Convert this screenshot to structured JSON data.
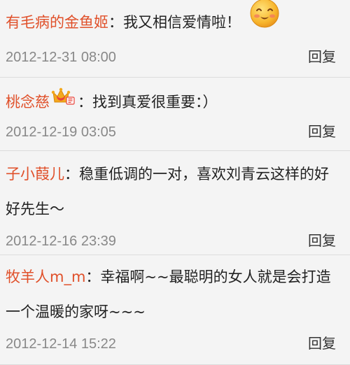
{
  "comments": [
    {
      "author": "有毛病的金鱼姬",
      "text": "：我又相信爱情啦！",
      "time": "2012-12-31 08:00",
      "reply": "回复",
      "emoji": "blushing-smile-emoji"
    },
    {
      "author": "桃念慈",
      "text": "：找到真爱很重要：）",
      "time": "2012-12-19 03:05",
      "reply": "回复",
      "badge": "vip-crown-icon"
    },
    {
      "author": "子小葭儿",
      "text": "：稳重低调的一对，喜欢刘青云这样的好好先生～",
      "time": "2012-12-16 23:39",
      "reply": "回复"
    },
    {
      "author": "牧羊人m_m",
      "text": "：幸福啊~~最聪明的女人就是会打造一个温暖的家呀~~~",
      "time": "2012-12-14 15:22",
      "reply": "回复"
    }
  ],
  "colors": {
    "author": "#e0502a",
    "text": "#222222",
    "time": "#888888",
    "background": "#f4f4f4",
    "divider": "#dcdcdc"
  }
}
